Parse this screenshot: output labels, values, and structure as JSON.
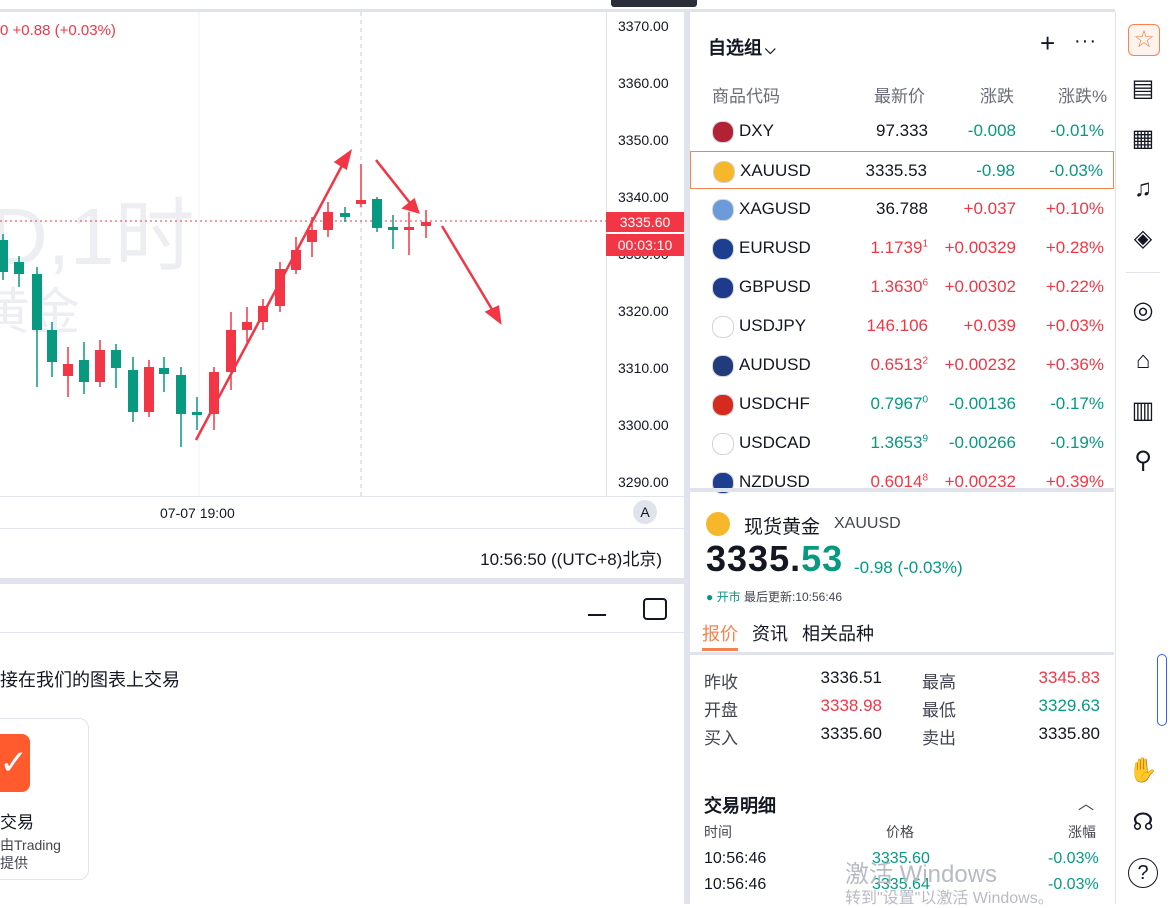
{
  "chart": {
    "ohlc_text": "0 +0.88 (+0.03%)",
    "watermark_symbol": "D,1时",
    "watermark_name": "黄金",
    "y_labels": [
      "3370.00",
      "3360.00",
      "3350.00",
      "3340.00",
      "3330.00",
      "3320.00",
      "3310.00",
      "3300.00",
      "3290.00"
    ],
    "current_price": "3335.60",
    "countdown": "00:03:10",
    "x_label": "07-07 19:00",
    "auto_label": "A",
    "clock": "10:56:50 ((UTC+8)北京)",
    "colors": {
      "up": "#f23645",
      "down": "#089981",
      "arrow": "#f23645"
    }
  },
  "bottom_panel": {
    "lead_text": "接在我们的图表上交易",
    "card_title": "交易",
    "card_sub1": "由Trading",
    "card_sub2": "提供"
  },
  "watchlist": {
    "title": "自选组",
    "columns": [
      "商品代码",
      "最新价",
      "涨跌",
      "涨跌%"
    ],
    "rows": [
      {
        "sym": "DXY",
        "last": "97.333",
        "sup": "",
        "chg": "-0.008",
        "pct": "-0.01%",
        "dir": "down",
        "flag": "us"
      },
      {
        "sym": "XAUUSD",
        "last": "3335.53",
        "sup": "",
        "chg": "-0.98",
        "pct": "-0.03%",
        "dir": "down",
        "flag": "gold",
        "selected": true
      },
      {
        "sym": "XAGUSD",
        "last": "36.788",
        "sup": "",
        "chg": "+0.037",
        "pct": "+0.10%",
        "dir": "up",
        "flag": "silver"
      },
      {
        "sym": "EURUSD",
        "last": "1.1739",
        "sup": "1",
        "chg": "+0.00329",
        "pct": "+0.28%",
        "dir": "up",
        "flag": "eu"
      },
      {
        "sym": "GBPUSD",
        "last": "1.3630",
        "sup": "6",
        "chg": "+0.00302",
        "pct": "+0.22%",
        "dir": "up",
        "flag": "gb"
      },
      {
        "sym": "USDJPY",
        "last": "146.106",
        "sup": "",
        "chg": "+0.039",
        "pct": "+0.03%",
        "dir": "up",
        "flag": "jp"
      },
      {
        "sym": "AUDUSD",
        "last": "0.6513",
        "sup": "2",
        "chg": "+0.00232",
        "pct": "+0.36%",
        "dir": "up",
        "flag": "au"
      },
      {
        "sym": "USDCHF",
        "last": "0.7967",
        "sup": "0",
        "chg": "-0.00136",
        "pct": "-0.17%",
        "dir": "down",
        "flag": "ch"
      },
      {
        "sym": "USDCAD",
        "last": "1.3653",
        "sup": "9",
        "chg": "-0.00266",
        "pct": "-0.19%",
        "dir": "down",
        "flag": "ca"
      },
      {
        "sym": "NZDUSD",
        "last": "0.6014",
        "sup": "8",
        "chg": "+0.00232",
        "pct": "+0.39%",
        "dir": "up",
        "flag": "nz"
      }
    ]
  },
  "detail": {
    "name": "现货黄金",
    "code": "XAUUSD",
    "price_int": "3335.",
    "price_dec": "53",
    "change": "-0.98 (-0.03%)",
    "status": "开市",
    "updated": "最后更新:10:56:46",
    "tabs": [
      "报价",
      "资讯",
      "相关品种"
    ],
    "quotes": [
      {
        "label": "昨收",
        "value": "3336.51",
        "dir": "none",
        "label2": "最高",
        "value2": "3345.83",
        "dir2": "up"
      },
      {
        "label": "开盘",
        "value": "3338.98",
        "dir": "up",
        "label2": "最低",
        "value2": "3329.63",
        "dir2": "down"
      },
      {
        "label": "买入",
        "value": "3335.60",
        "dir": "none",
        "label2": "卖出",
        "value2": "3335.80",
        "dir2": "none"
      }
    ],
    "trades_title": "交易明细",
    "trades_cols": [
      "时间",
      "价格",
      "涨幅"
    ],
    "trades": [
      {
        "time": "10:56:46",
        "price": "3335.60",
        "pct": "-0.03%"
      },
      {
        "time": "10:56:46",
        "price": "3335.64",
        "pct": "-0.03%"
      }
    ]
  },
  "watermark_win": "激活 Windows",
  "watermark_win2": "转到\"设置\"以激活 Windows。"
}
